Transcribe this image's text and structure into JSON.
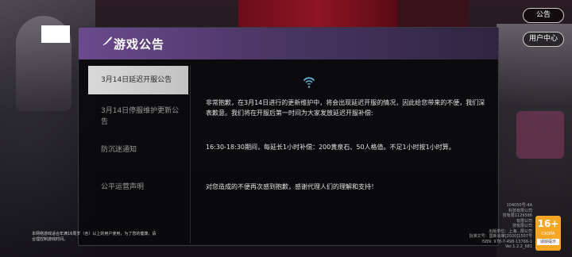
{
  "top_buttons": {
    "notice": "公告",
    "user_center": "用户中心"
  },
  "modal": {
    "title": "游戏公告",
    "sidebar": [
      {
        "label": "3月14日延迟开服公告",
        "active": true
      },
      {
        "label": "3月14日停服维护更新公告",
        "active": false
      },
      {
        "label": "防沉迷通知",
        "active": false
      },
      {
        "label": "公平运营声明",
        "active": false
      }
    ],
    "content": {
      "p1": "非常抱歉，在3月14日进行的更新维护中，将会出现延迟开服的情况，因此给您带来的不便，我们深表歉意。我们将在开服后第一时间为大家发放延迟开服补偿:",
      "p2": "16:30-18:30期间，每延长1小时补偿：200黄泉石、50人格值。不足1小时按1小时算。",
      "p3": "对您造成的不便再次感到抱歉，感谢代理人们的理解和支持！"
    }
  },
  "bottom": {
    "age_note": "本网络游戏适合年满16周岁（含）以上的用户使用，为了您的健康，请合理控制游戏时间。",
    "license_lines": [
      "104050号-4A",
      "科技有限公司",
      "技有限1129586",
      "有限公司",
      "技有限公司",
      "出版单位：上海...限公司",
      "批准文号：国新出审[2020]1507号",
      "ISBN: 978-7-498-13766-1"
    ],
    "version": "Ver.1.2.2_681",
    "age_rating": {
      "number": "16+",
      "org": "CADPA",
      "tip": "适龄提示"
    }
  },
  "colors": {
    "header": "#5a3f7a",
    "active_tab": "#d0d0d0",
    "badge": "#f5a623"
  }
}
